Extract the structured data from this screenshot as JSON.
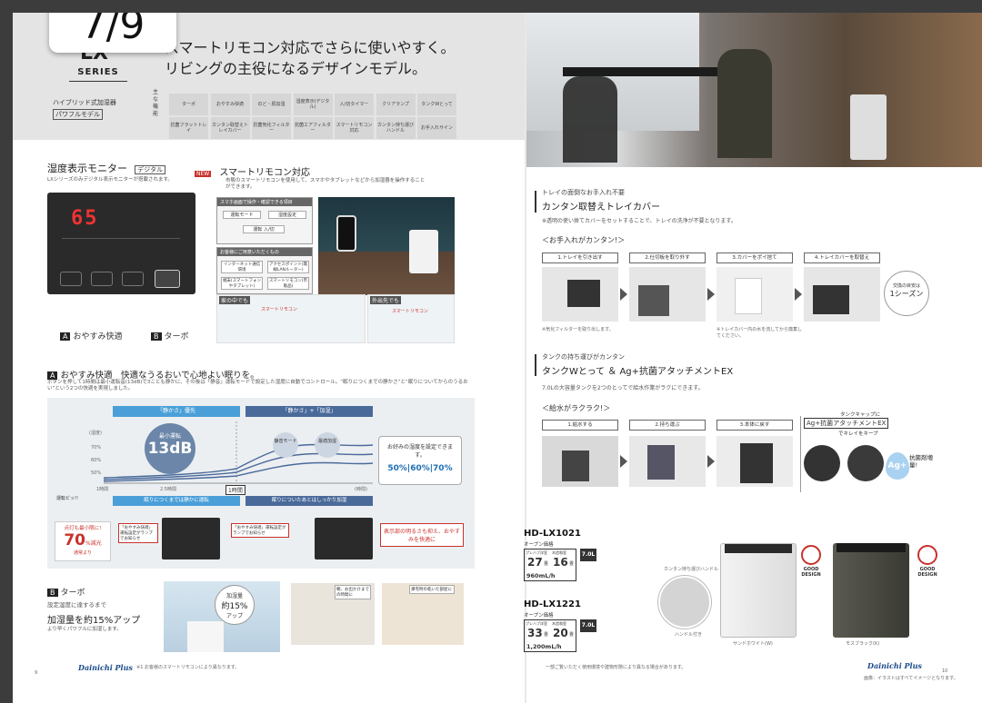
{
  "page_indicator": "7/9",
  "left": {
    "series": "SERIES",
    "logo_partial": "LX",
    "headline1": "スマートリモコン対応でさらに使いやすく。",
    "headline2": "リビングの主役になるデザインモデル。",
    "type_label": "ハイブリッド式加湿器",
    "power_label": "パワフルモデル",
    "features_heading": "主な機能",
    "features": [
      "ターボ",
      "おやすみ快適",
      "のど・肌加湿",
      "湿度表示(デジタル)",
      "入/切タイマー",
      "クリアランプ",
      "タンクWとって",
      "抗菌フラットトレイ",
      "カンタン取替えトレイカバー",
      "抗菌気化フィルター",
      "抗菌エアフィルター",
      "スマートリモコン対応",
      "カンタン持ち運びハンドル",
      "お手入れサイン"
    ],
    "humidity_monitor_title": "湿度表示モニター",
    "digital": "デジタル",
    "monitor_note": "LXシリーズのみデジタル表示モニターが搭載されます。",
    "panel_display": "65",
    "new_badge": "NEW",
    "smart_title": "スマートリモコン対応",
    "smart_desc": "市販のスマートリモコンを使用して、スマホやタブレットなどから加湿器を操作することができます。",
    "app_box_title": "スマホ画面で操作・確認できる項目",
    "app_items": [
      "運転モード",
      "湿度設定",
      "運転 入/切"
    ],
    "needs_title": "お客様にご用意いただくもの",
    "needs_items": [
      "インターネット通信環境",
      "アクセスポイント(無線LANルーター)",
      "端末(スマートフォンやタブレット)",
      "スマートリモコン(市販品)"
    ],
    "scene_home": "家の中でも",
    "scene_out": "外出先でも",
    "scene_tag1": "スマートリモコン",
    "scene_tag2": "スマートリモコン",
    "label_a": "A",
    "label_a_text": "おやすみ快適",
    "label_b": "B",
    "label_b_text": "ターボ",
    "oyasumi_title": "おやすみ快適　快適なうるおいで心地よい眠りを。",
    "oyasumi_desc": "ボタンを押して1時間は最小運転音(13dB)で3ことも静かに、その後は「静音」運転モードで設定した湿度に自動でコントロール。“眠りにつくまでの静かさ”と“眠りについてからのうるおい”という2つの快適を実現しました。",
    "graph_phase1": "「静かさ」優先",
    "graph_phase2": "「静かさ」+「加湿」",
    "graph_min_label": "最小運転",
    "graph_db": "13dB",
    "graph_y": [
      "(湿度)",
      "70%",
      "60%",
      "50%"
    ],
    "graph_x": [
      "1時間",
      "2.5時間",
      "1時間",
      "(時間)"
    ],
    "graph_mode1": "静音モード",
    "graph_mode2": "最適加湿",
    "graph_bubble": "お好みの湿度を設定できます。",
    "graph_pcts": "50%|60%|70%",
    "band1": "眠りにつくまでは静かに運転",
    "band2": "眠りについたあとはしっかり加湿",
    "pipi": "運転ピッ!!",
    "dim": "点灯も最小限に!",
    "dim_pct": "70",
    "dim_unit": "%減光",
    "dim_sub": "通常より",
    "ctrl_note1": "「おやすみ快適」運転設定がランプでお知らせ",
    "ctrl_note2": "「おやすみ快適」運転設定がランプでお知らせ",
    "dim_right": "表示部の明るさも抑え、おやすみを快適に",
    "turbo_title": "ターボ",
    "turbo_text1": "設定湿度に達するまで",
    "turbo_text2": "加湿量を約15%アップ",
    "turbo_text3": "より早くパワフルに加湿します。",
    "turbo_bubble1": "加湿量",
    "turbo_bubble2": "約15%",
    "turbo_bubble3": "アップ",
    "turbo_img1": "朝、お出かけまでの時間に",
    "turbo_img2": "帰宅時の乾いた部屋に",
    "footnote": "※1 お客様のスマートリモコンにより異なります。",
    "page_num": "9",
    "brand": "Dainichi Plus"
  },
  "right": {
    "tray_kicker": "トレイの面倒なお手入れ不要",
    "tray_title": "カンタン取替えトレイカバー",
    "tray_desc": "※透明の使い捨てカバーをセットすることで、トレイの洗浄が不要となります。",
    "care_easy": "＜お手入れがカンタン!＞",
    "care_steps": [
      "1.トレイを引き出す",
      "2.仕切板を取り外す",
      "3.カバーをポイ捨て",
      "4.トレイカバーを取替え"
    ],
    "care_note1": "※気化フィルターを取り出します。",
    "care_note2": "※トレイカバー内の水を流してから廃棄してください。",
    "care_bubble1": "交換の目安は",
    "care_bubble2": "1シーズン",
    "tank_kicker": "タンクの持ち運びがカンタン",
    "tank_title": "タンクWとって ＆ Ag+抗菌アタッチメントEX",
    "tank_desc": "7.0Lの大容量タンクを2つのとってで給水作業がラクにできます。",
    "water_easy": "＜給水がラクラク!＞",
    "water_steps": [
      "1.給水する",
      "2.持ち運ぶ",
      "3.本体に戻す"
    ],
    "cap_title": "タンクキャップに",
    "cap_title2": "Ag+抗菌アタッチメントEX",
    "cap_title3": "でキレイをキープ",
    "ag": "Ag+",
    "ag_text": "抗菌剤増量!",
    "models": [
      {
        "name": "HD-LX1021",
        "price": "オープン価格",
        "tank": "7.0L",
        "area1": "27",
        "area1_unit": "畳",
        "area2": "16",
        "area2_unit": "畳",
        "rate": "960mL/h"
      },
      {
        "name": "HD-LX1221",
        "price": "オープン価格",
        "tank": "7.0L",
        "area1": "33",
        "area1_unit": "畳",
        "area2": "20",
        "area2_unit": "畳",
        "rate": "1,200mL/h"
      }
    ],
    "area_headers": [
      "プレハブ洋室",
      "木造和室"
    ],
    "handle_note": "ハンドル付き",
    "handle_label": "カンタン持ち運びハンドル",
    "color1": "サンドホワイト(W)",
    "color2": "モスブラック(K)",
    "good_design": "GOOD DESIGN",
    "footnote": "一部ご覧いただく使用環境や建物形態により異なる場合があります。",
    "page_num": "10",
    "photo_note": "画像：イラストはすべてイメージとなります。"
  },
  "colors": {
    "accent": "#1f6fb5",
    "red": "#c8322c",
    "band": "#4a9fd8"
  }
}
